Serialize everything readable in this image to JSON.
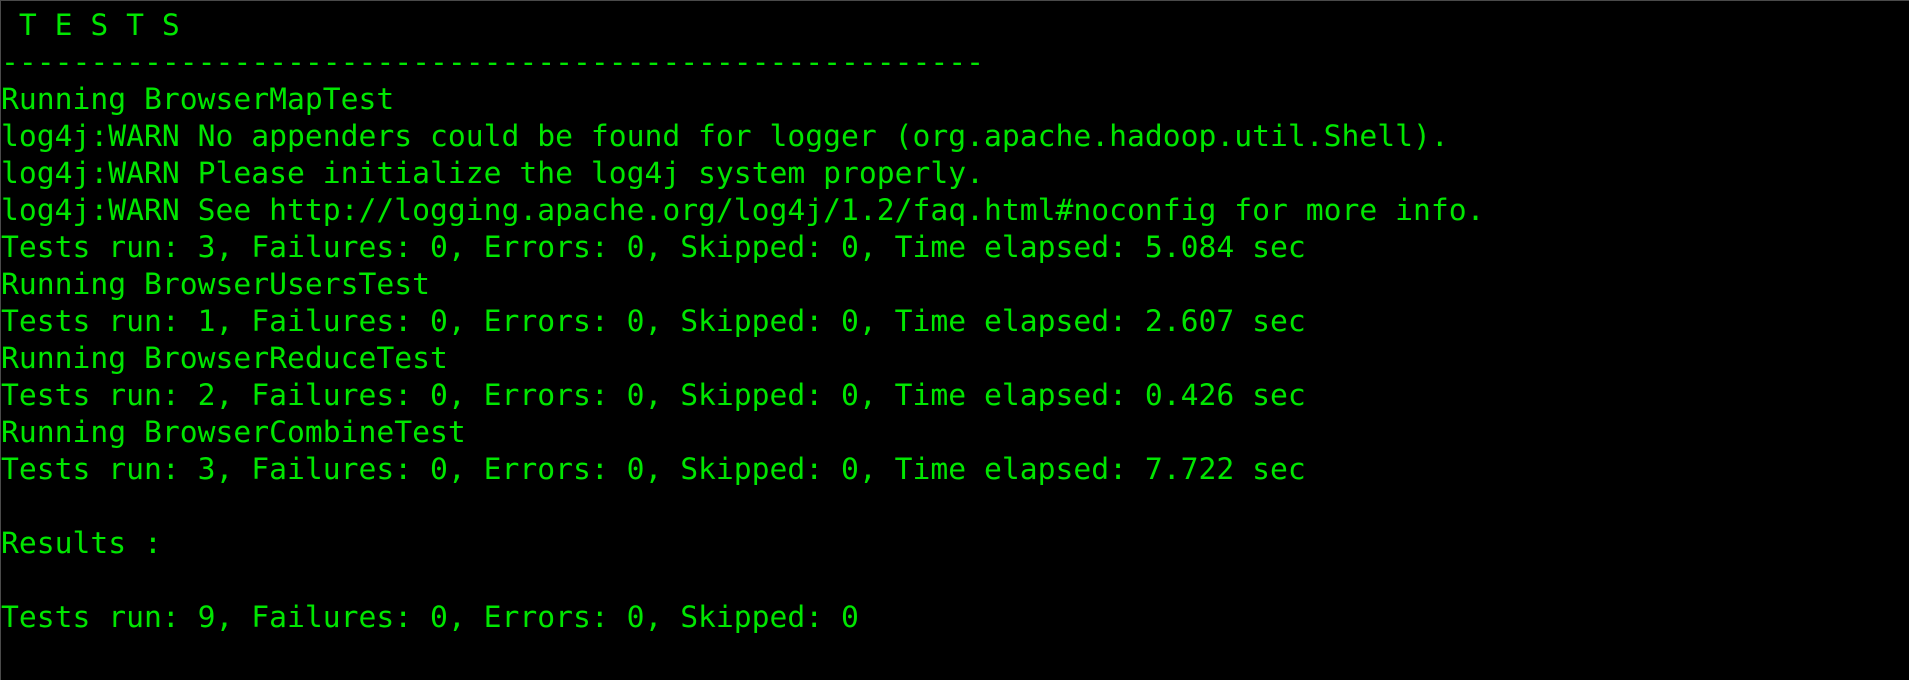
{
  "terminal": {
    "text_color": "#00e600",
    "background_color": "#000000",
    "lines": [
      " T E S T S",
      "-------------------------------------------------------",
      "Running BrowserMapTest",
      "log4j:WARN No appenders could be found for logger (org.apache.hadoop.util.Shell).",
      "log4j:WARN Please initialize the log4j system properly.",
      "log4j:WARN See http://logging.apache.org/log4j/1.2/faq.html#noconfig for more info.",
      "Tests run: 3, Failures: 0, Errors: 0, Skipped: 0, Time elapsed: 5.084 sec",
      "Running BrowserUsersTest",
      "Tests run: 1, Failures: 0, Errors: 0, Skipped: 0, Time elapsed: 2.607 sec",
      "Running BrowserReduceTest",
      "Tests run: 2, Failures: 0, Errors: 0, Skipped: 0, Time elapsed: 0.426 sec",
      "Running BrowserCombineTest",
      "Tests run: 3, Failures: 0, Errors: 0, Skipped: 0, Time elapsed: 7.722 sec",
      "",
      "Results :",
      "",
      "Tests run: 9, Failures: 0, Errors: 0, Skipped: 0"
    ]
  }
}
